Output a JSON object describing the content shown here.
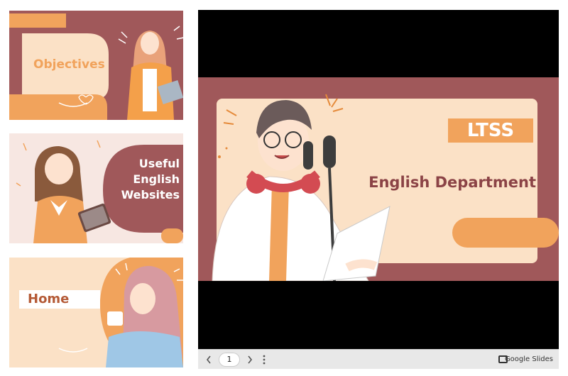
{
  "thumbnails": [
    {
      "title": "Objectives"
    },
    {
      "title": "Useful English Websites"
    },
    {
      "title": "Home"
    }
  ],
  "slide": {
    "badge": "LTSS",
    "subtitle": "English Department"
  },
  "controls": {
    "prev_icon": "chevron-left-icon",
    "page": "1",
    "next_icon": "chevron-right-icon",
    "more_icon": "more-vert-icon",
    "brand": "Google Slides"
  },
  "colors": {
    "maroon": "#a0585a",
    "peach": "#fbe1c6",
    "orange": "#f1a35c",
    "title_brown": "#8b4346"
  }
}
